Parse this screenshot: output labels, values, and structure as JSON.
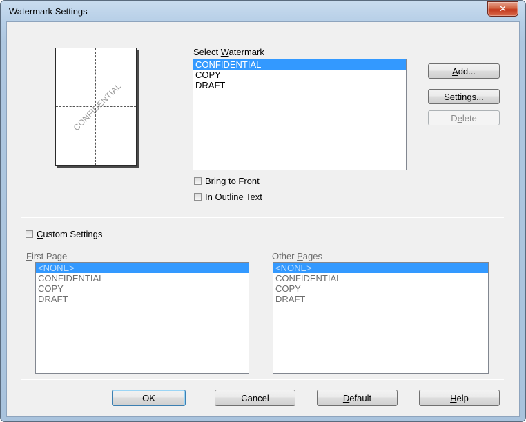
{
  "window": {
    "title": "Watermark Settings",
    "close_glyph": "✕"
  },
  "preview": {
    "watermark_text": "CONFIDENTIAL"
  },
  "select_watermark": {
    "label_pre": "Select ",
    "label_key": "W",
    "label_post": "atermark",
    "items": [
      "CONFIDENTIAL",
      "COPY",
      "DRAFT"
    ],
    "selected_index": 0
  },
  "buttons": {
    "add": {
      "key": "A",
      "rest": "dd..."
    },
    "settings": {
      "key": "S",
      "rest": "ettings..."
    },
    "delete": {
      "pre": "D",
      "key": "e",
      "rest": "lete"
    },
    "ok": "OK",
    "cancel": "Cancel",
    "default": {
      "key": "D",
      "rest": "efault"
    },
    "help": {
      "key": "H",
      "rest": "elp"
    }
  },
  "options": {
    "bring_to_front": {
      "key": "B",
      "rest": "ring to Front",
      "checked": false
    },
    "outline_text": {
      "pre": "In ",
      "key": "O",
      "rest": "utline Text",
      "checked": false
    }
  },
  "custom_settings": {
    "key": "C",
    "rest": "ustom Settings",
    "checked": false
  },
  "first_page": {
    "label_key": "F",
    "label_rest": "irst Page",
    "items": [
      "<NONE>",
      "CONFIDENTIAL",
      "COPY",
      "DRAFT"
    ],
    "selected_index": 0
  },
  "other_pages": {
    "label_pre": "Other ",
    "label_key": "P",
    "label_rest": "ages",
    "items": [
      "<NONE>",
      "CONFIDENTIAL",
      "COPY",
      "DRAFT"
    ],
    "selected_index": 0
  }
}
